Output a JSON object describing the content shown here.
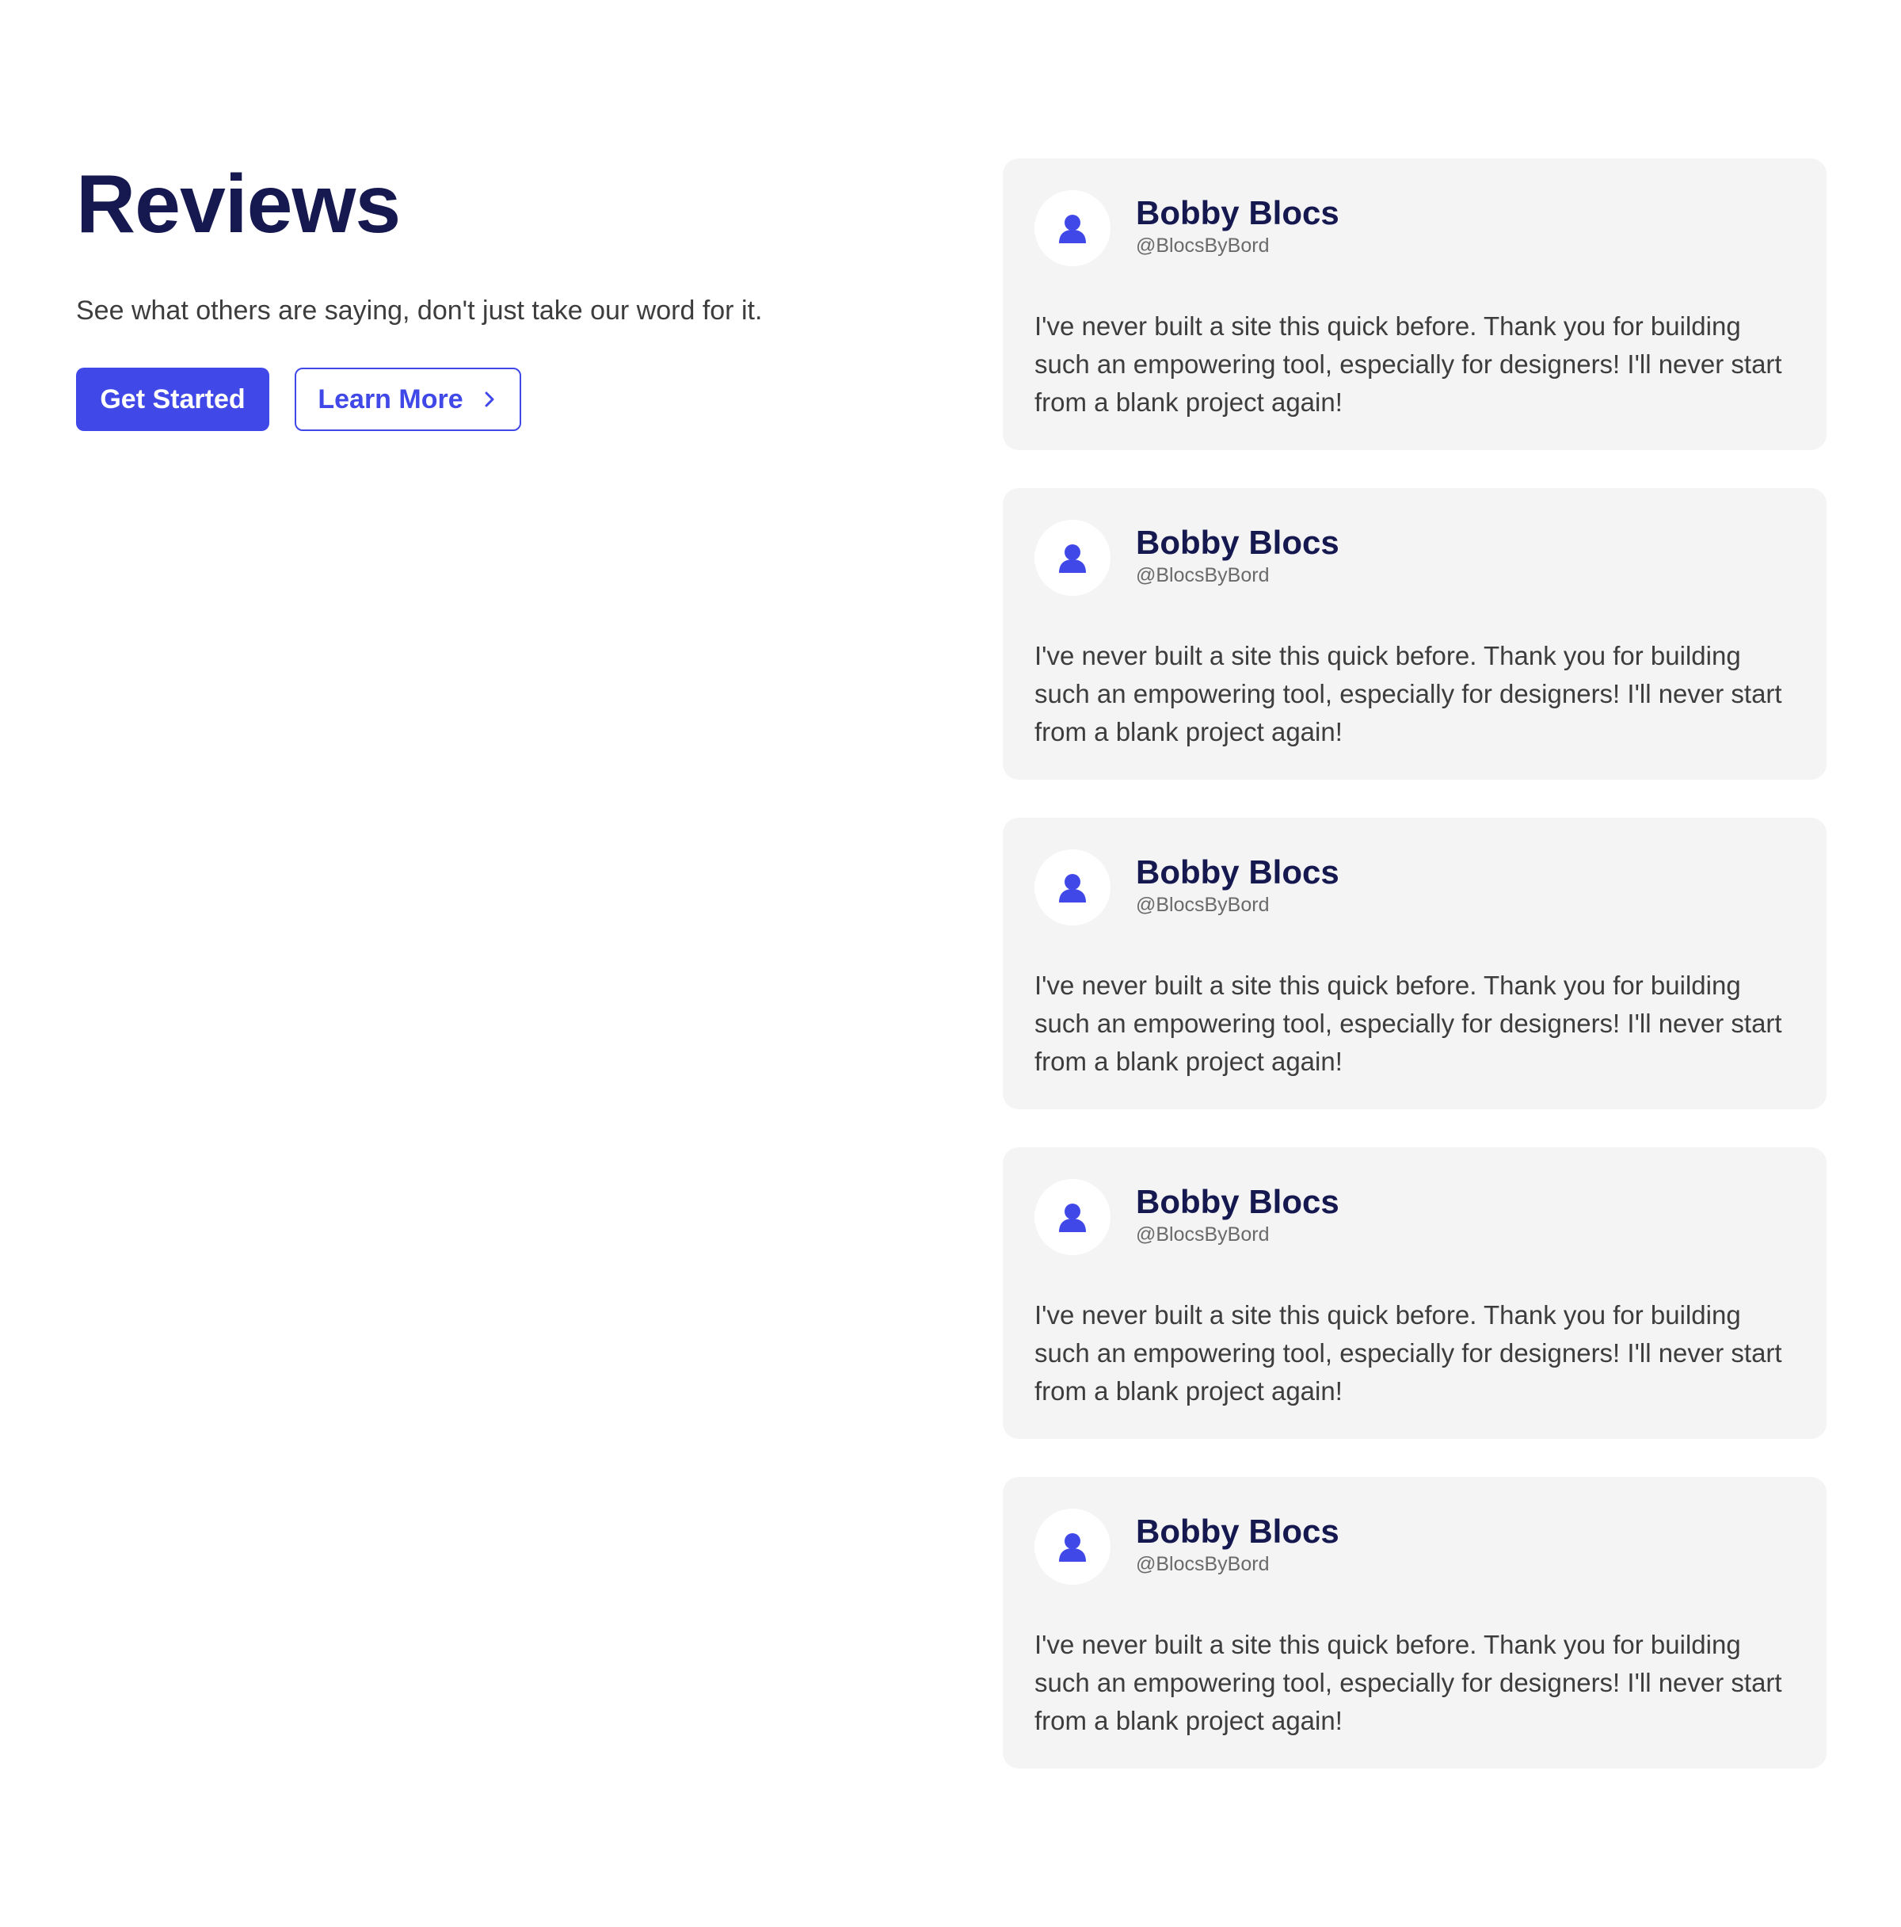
{
  "hero": {
    "title": "Reviews",
    "subtitle": "See what others are saying, don't just take our word for it.",
    "primary_button": "Get Started",
    "secondary_button": "Learn More"
  },
  "colors": {
    "accent": "#4049e8",
    "heading": "#16194f",
    "card_bg": "#f4f4f4"
  },
  "reviews": [
    {
      "name": "Bobby Blocs",
      "handle": "@BlocsByBord",
      "text": "I've never built a site this quick before. Thank you for building such an empowering tool, especially for designers! I'll never start from a blank project again!"
    },
    {
      "name": "Bobby Blocs",
      "handle": "@BlocsByBord",
      "text": "I've never built a site this quick before. Thank you for building such an empowering tool, especially for designers! I'll never start from a blank project again!"
    },
    {
      "name": "Bobby Blocs",
      "handle": "@BlocsByBord",
      "text": "I've never built a site this quick before. Thank you for building such an empowering tool, especially for designers! I'll never start from a blank project again!"
    },
    {
      "name": "Bobby Blocs",
      "handle": "@BlocsByBord",
      "text": "I've never built a site this quick before. Thank you for building such an empowering tool, especially for designers! I'll never start from a blank project again!"
    },
    {
      "name": "Bobby Blocs",
      "handle": "@BlocsByBord",
      "text": "I've never built a site this quick before. Thank you for building such an empowering tool, especially for designers! I'll never start from a blank project again!"
    }
  ]
}
